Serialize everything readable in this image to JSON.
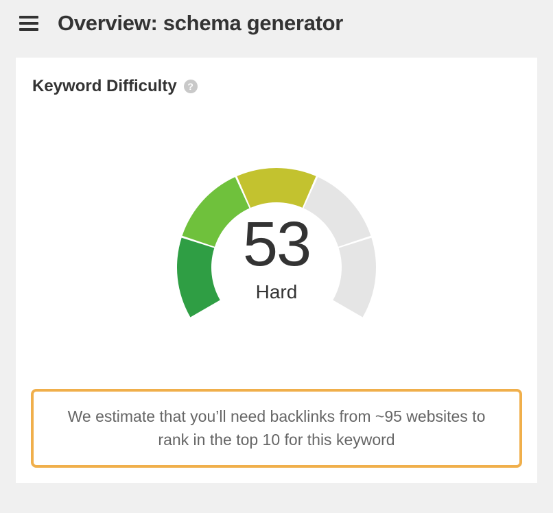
{
  "header": {
    "title": "Overview: schema generator"
  },
  "card": {
    "title": "Keyword Difficulty",
    "help_glyph": "?"
  },
  "chart_data": {
    "type": "gauge",
    "value": 53,
    "max": 100,
    "label": "Hard",
    "segments": [
      {
        "start": 0,
        "end": 20,
        "color": "#2f9e44",
        "filled": true
      },
      {
        "start": 20,
        "end": 40,
        "color": "#66bf3c",
        "filled": true
      },
      {
        "start": 40,
        "end": 60,
        "color": "#c0ca33",
        "filled": true
      },
      {
        "start": 60,
        "end": 80,
        "color": "#e5e5e5",
        "filled": false
      },
      {
        "start": 80,
        "end": 100,
        "color": "#e5e5e5",
        "filled": false
      }
    ],
    "arc_range_deg": {
      "start": 210,
      "end": -30
    },
    "title": "Keyword Difficulty"
  },
  "estimate": {
    "text": "We estimate that you’ll need backlinks from ~95 websites to rank in the top 10 for this keyword"
  }
}
